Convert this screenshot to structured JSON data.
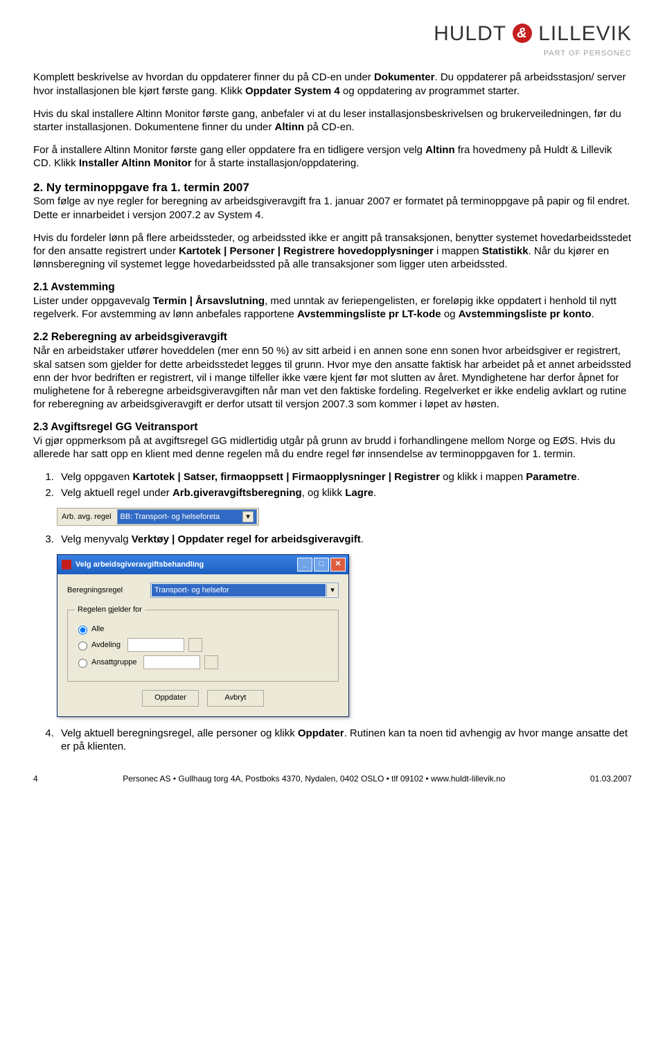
{
  "logo": {
    "left": "HULDT",
    "right": "LILLEVIK",
    "sub": "PART OF PERSONEC"
  },
  "p1a": "Komplett beskrivelse av hvordan du oppdaterer finner du på CD-en under ",
  "p1b": "Dokumenter",
  "p1c": ". Du oppdaterer på arbeidsstasjon/ server hvor installasjonen ble kjørt første gang. Klikk ",
  "p1d": "Oppdater System 4",
  "p1e": " og oppdatering av programmet starter.",
  "p2a": "Hvis du skal installere Altinn Monitor første gang, anbefaler vi at du leser installasjonsbeskrivelsen og brukerveiledningen, før du starter installasjonen. Dokumentene finner du under ",
  "p2b": "Altinn",
  "p2c": " på CD-en.",
  "p3a": "For å installere Altinn Monitor første gang eller oppdatere fra en tidligere versjon velg ",
  "p3b": "Altinn",
  "p3c": " fra hovedmeny på Huldt & Lillevik CD. Klikk ",
  "p3d": "Installer Altinn Monitor",
  "p3e": " for å starte installasjon/oppdatering.",
  "h2": "2. Ny terminoppgave fra 1. termin 2007",
  "p4": "Som følge av nye regler for beregning av arbeidsgiveravgift fra 1. januar 2007 er formatet på terminoppgave på papir og fil endret. Dette er innarbeidet i versjon 2007.2 av System 4.",
  "p5a": "Hvis du fordeler lønn på flere arbeidssteder, og arbeidssted ikke er angitt på transaksjonen, benytter systemet hovedarbeidsstedet for den ansatte registrert under ",
  "p5b": "Kartotek | Personer | Registrere hovedopplysninger",
  "p5c": " i mappen ",
  "p5d": "Statistikk",
  "p5e": ". Når du kjører en lønnsberegning vil systemet legge hovedarbeidssted på alle transaksjoner som ligger uten arbeidssted.",
  "h21": "2.1 Avstemming",
  "p6a": "Lister under oppgavevalg ",
  "p6b": "Termin | Årsavslutning",
  "p6c": ", med unntak av feriepengelisten, er foreløpig ikke oppdatert i henhold til nytt regelverk. For avstemming av lønn anbefales rapportene ",
  "p6d": "Avstemmingsliste pr LT-kode",
  "p6e": " og ",
  "p6f": "Avstemmingsliste pr konto",
  "p6g": ".",
  "h22": "2.2 Reberegning av arbeidsgiveravgift",
  "p7": "Når en arbeidstaker utfører hoveddelen (mer enn 50 %) av sitt arbeid i en annen sone enn sonen hvor arbeidsgiver er registrert, skal satsen som gjelder for dette arbeidsstedet legges til grunn. Hvor mye den ansatte faktisk har arbeidet på et annet arbeidssted enn der hvor bedriften er registrert, vil i mange tilfeller ikke være kjent før mot slutten av året. Myndighetene har derfor åpnet for mulighetene for å reberegne arbeidsgiveravgiften når man vet den faktiske fordeling. Regelverket er ikke endelig avklart og rutine for reberegning av arbeidsgiveravgift er derfor utsatt til versjon 2007.3 som kommer i løpet av høsten.",
  "h23": "2.3 Avgiftsregel GG Veitransport",
  "p8": "Vi gjør oppmerksom på at avgiftsregel GG midlertidig utgår på grunn av brudd i forhandlingene mellom Norge og EØS. Hvis du allerede har satt opp en klient med denne regelen må du endre regel før innsendelse av terminoppgaven for 1. termin.",
  "li1a": "Velg oppgaven ",
  "li1b": "Kartotek | Satser, firmaoppsett | Firmaopplysninger | Registrer",
  "li1c": " og klikk i mappen ",
  "li1d": "Parametre",
  "li1e": ".",
  "li2a": "Velg aktuell regel under ",
  "li2b": "Arb.giveravgiftsberegning",
  "li2c": ", og klikk ",
  "li2d": "Lagre",
  "li2e": ".",
  "dd_label": "Arb. avg. regel",
  "dd_value": "BB: Transport- og helseforeta",
  "li3a": "Velg menyvalg ",
  "li3b": "Verktøy | Oppdater regel for arbeidsgiveravgift",
  "li3c": ".",
  "dialog": {
    "title": "Velg arbeidsgiveravgiftsbehandling",
    "field_label": "Beregningsregel",
    "field_value": "Transport- og helsefor",
    "group_label": "Regelen gjelder for",
    "r1": "Alle",
    "r2": "Avdeling",
    "r3": "Ansattgruppe",
    "ok": "Oppdater",
    "cancel": "Avbryt"
  },
  "li4a": "Velg aktuell beregningsregel, alle personer og klikk ",
  "li4b": "Oppdater",
  "li4c": ". Rutinen kan ta noen tid avhengig av hvor mange ansatte det er på klienten.",
  "footer": {
    "page": "4",
    "center": "Personec AS • Gullhaug torg 4A, Postboks 4370, Nydalen, 0402 OSLO • tlf 09102 • www.huldt-lillevik.no",
    "date": "01.03.2007"
  }
}
